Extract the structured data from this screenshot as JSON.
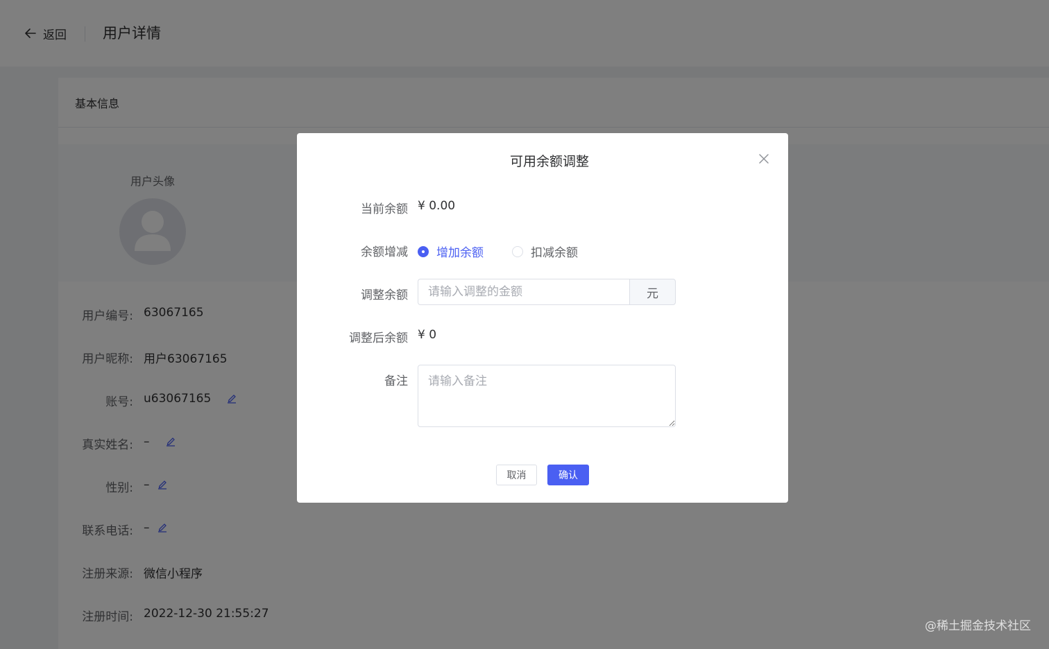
{
  "header": {
    "back_label": "返回",
    "title": "用户详情"
  },
  "basic_info": {
    "section_title": "基本信息",
    "avatar_label": "用户头像",
    "rows": [
      {
        "label": "用户编号:",
        "value": "63067165",
        "editable": false
      },
      {
        "label": "用户昵称:",
        "value": "用户63067165",
        "editable": false
      },
      {
        "label": "账号:",
        "value": "u63067165",
        "editable": true
      },
      {
        "label": "真实姓名:",
        "value": "–",
        "editable": true
      },
      {
        "label": "性别:",
        "value": "–",
        "editable": true
      },
      {
        "label": "联系电话:",
        "value": "–",
        "editable": true
      },
      {
        "label": "注册来源:",
        "value": "微信小程序",
        "editable": false
      },
      {
        "label": "注册时间:",
        "value": "2022-12-30 21:55:27",
        "editable": false
      }
    ]
  },
  "dialog": {
    "title": "可用余额调整",
    "current_balance_label": "当前余额",
    "current_balance_value": "¥ 0.00",
    "adjust_type_label": "余额增减",
    "options": [
      {
        "label": "增加余额",
        "checked": true
      },
      {
        "label": "扣减余额",
        "checked": false
      }
    ],
    "adjust_amount_label": "调整余额",
    "adjust_amount_placeholder": "请输入调整的金额",
    "adjust_amount_unit": "元",
    "after_balance_label": "调整后余额",
    "after_balance_value": "¥ 0",
    "remark_label": "备注",
    "remark_placeholder": "请输入备注",
    "cancel_label": "取消",
    "confirm_label": "确认"
  },
  "watermark": "@稀土掘金技术社区",
  "colors": {
    "accent": "#4a5ff2",
    "mask": "rgba(0,0,0,0.5)",
    "edit_icon": "#4a5ff2"
  },
  "icons": {
    "back": "arrow-left-icon",
    "close": "close-icon",
    "edit": "edit-pen-icon",
    "avatar": "user-avatar-icon"
  }
}
